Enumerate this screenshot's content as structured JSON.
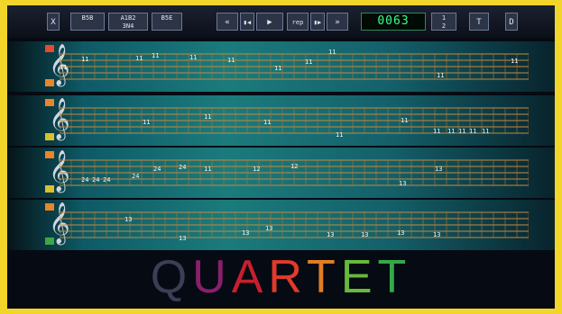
{
  "toolbar": {
    "close_label": "X",
    "mode_buttons": [
      "B5B",
      "A1B2\n3N4",
      "B5E"
    ],
    "rewind_label": "«",
    "back_label": "▮◀",
    "play_label": "▶",
    "rep_label": "rep",
    "forward_label": "▮▶",
    "fast_forward_label": "»",
    "counter": "0063",
    "tempo_label": "1\n2",
    "mode_label": "T",
    "extra_label": "D"
  },
  "tracks": [
    {
      "name": "track-1",
      "swatches": [
        "#e74a2e",
        "#e8862b"
      ],
      "notes": [
        {
          "t": "11"
        },
        {
          "t": "11"
        },
        {
          "t": "11"
        },
        {
          "t": "11"
        },
        {
          "t": "11"
        },
        {
          "t": "11"
        },
        {
          "t": "11"
        },
        {
          "t": "11"
        },
        {
          "t": "11"
        },
        {
          "t": "11"
        },
        {
          "t": "11"
        }
      ]
    },
    {
      "name": "track-2",
      "swatches": [
        "#e8862b",
        "#d9c02c"
      ],
      "notes": [
        {
          "t": "11"
        },
        {
          "t": "11"
        },
        {
          "t": "11"
        },
        {
          "t": "11"
        },
        {
          "t": "11"
        },
        {
          "t": "11"
        },
        {
          "t": "11"
        },
        {
          "t": "11"
        },
        {
          "t": "11"
        },
        {
          "t": "11"
        }
      ]
    },
    {
      "name": "track-3",
      "swatches": [
        "#e8862b",
        "#d9c02c"
      ],
      "notes": [
        {
          "t": "24"
        },
        {
          "t": "24"
        },
        {
          "t": "24"
        },
        {
          "t": "24"
        },
        {
          "t": "24"
        },
        {
          "t": "24"
        },
        {
          "t": "11"
        },
        {
          "t": "12"
        },
        {
          "t": "12"
        },
        {
          "t": "13"
        },
        {
          "t": "13"
        }
      ]
    },
    {
      "name": "track-4",
      "swatches": [
        "#e8862b",
        "#3aa845"
      ],
      "notes": [
        {
          "t": "13"
        },
        {
          "t": "13"
        },
        {
          "t": "13"
        },
        {
          "t": "13"
        },
        {
          "t": "13"
        },
        {
          "t": "13"
        },
        {
          "t": "13"
        },
        {
          "t": "13"
        }
      ]
    }
  ],
  "title": {
    "letters": [
      {
        "ch": "Q",
        "color": "#3a3f55"
      },
      {
        "ch": "U",
        "color": "#8a1f6e"
      },
      {
        "ch": "A",
        "color": "#c81f2e"
      },
      {
        "ch": "R",
        "color": "#e23a2a"
      },
      {
        "ch": "T",
        "color": "#e07d25"
      },
      {
        "ch": "E",
        "color": "#68b83a"
      },
      {
        "ch": "T",
        "color": "#35a84a"
      }
    ]
  }
}
